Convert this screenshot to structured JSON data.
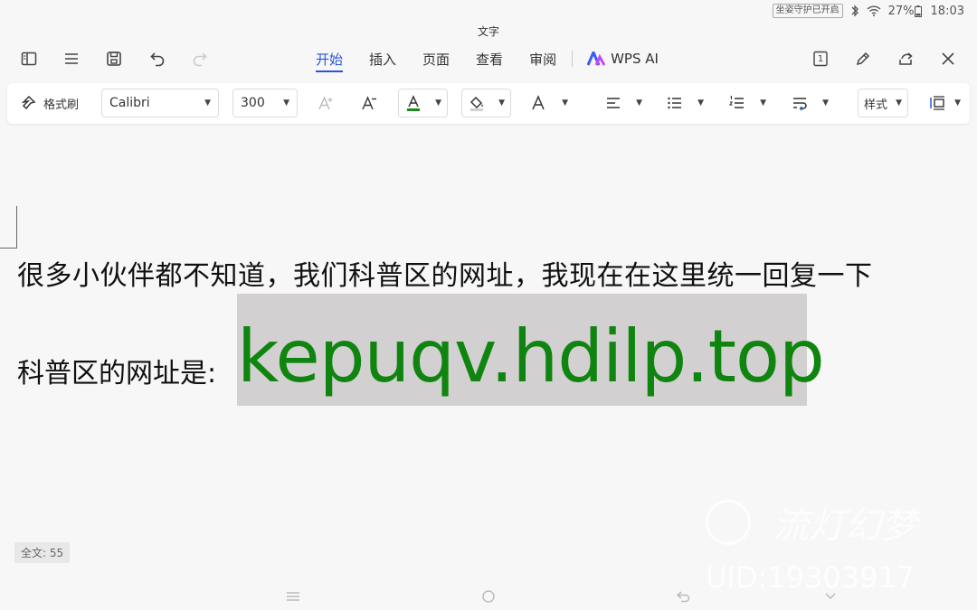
{
  "status": {
    "eye_mode": "坐姿守护已开启",
    "battery": "27%",
    "time": "18:03"
  },
  "window": {
    "title": "文字"
  },
  "tabs": [
    {
      "label": "开始",
      "active": true
    },
    {
      "label": "插入",
      "active": false
    },
    {
      "label": "页面",
      "active": false
    },
    {
      "label": "查看",
      "active": false
    },
    {
      "label": "审阅",
      "active": false
    }
  ],
  "wps_ai": {
    "label": "WPS AI"
  },
  "page_counter": "1",
  "ribbon": {
    "format_painter": "格式刷",
    "font_name": "Calibri",
    "font_size": "300",
    "styles": "样式"
  },
  "colors": {
    "accent": "#2a55d8",
    "font_color_bar": "#1a8a1a",
    "url_color": "#0f850f",
    "highlight": "#d3d0d1"
  },
  "document": {
    "line1": "很多小伙伴都不知道，我们科普区的网址，我现在在这里统一回复一下",
    "line2_prefix": "科普区的网址是:",
    "url": "kepuqv.hdilp.top"
  },
  "word_count": "全文: 55",
  "watermark": {
    "logo_text": "流灯幻梦",
    "uid": "UID:19303917"
  }
}
